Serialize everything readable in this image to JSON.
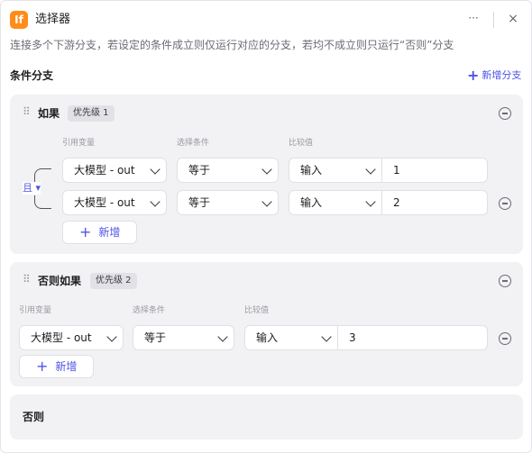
{
  "header": {
    "logo_text": "If",
    "title": "选择器",
    "more_icon": "···",
    "close_icon": "×"
  },
  "description": "连接多个下游分支，若设定的条件成立则仅运行对应的分支，若均不成立则只运行“否则”分支",
  "conditions_section": {
    "title": "条件分支",
    "add_branch_label": "新增分支"
  },
  "branches": [
    {
      "title": "如果",
      "priority": "优先级 1",
      "labels": {
        "variable": "引用变量",
        "condition": "选择条件",
        "compare": "比较值"
      },
      "logic": "且",
      "rows": [
        {
          "variable": "大模型 - output",
          "condition": "等于",
          "compare_type": "输入",
          "value": "1"
        },
        {
          "variable": "大模型 - output",
          "condition": "等于",
          "compare_type": "输入",
          "value": "2"
        }
      ],
      "add_label": "新增"
    },
    {
      "title": "否则如果",
      "priority": "优先级 2",
      "labels": {
        "variable": "引用变量",
        "condition": "选择条件",
        "compare": "比较值"
      },
      "rows": [
        {
          "variable": "大模型 - output",
          "condition": "等于",
          "compare_type": "输入",
          "value": "3"
        }
      ],
      "add_label": "新增"
    }
  ],
  "else_branch": {
    "title": "否则"
  },
  "colors": {
    "accent": "#4d53e8",
    "logo": "#ff8c1a",
    "card_bg": "#f2f2f4"
  },
  "icons": {
    "drag": "drag-handle-icon",
    "remove": "minus-circle-icon",
    "add": "plus-icon",
    "dropdown": "chevron-down-icon"
  }
}
